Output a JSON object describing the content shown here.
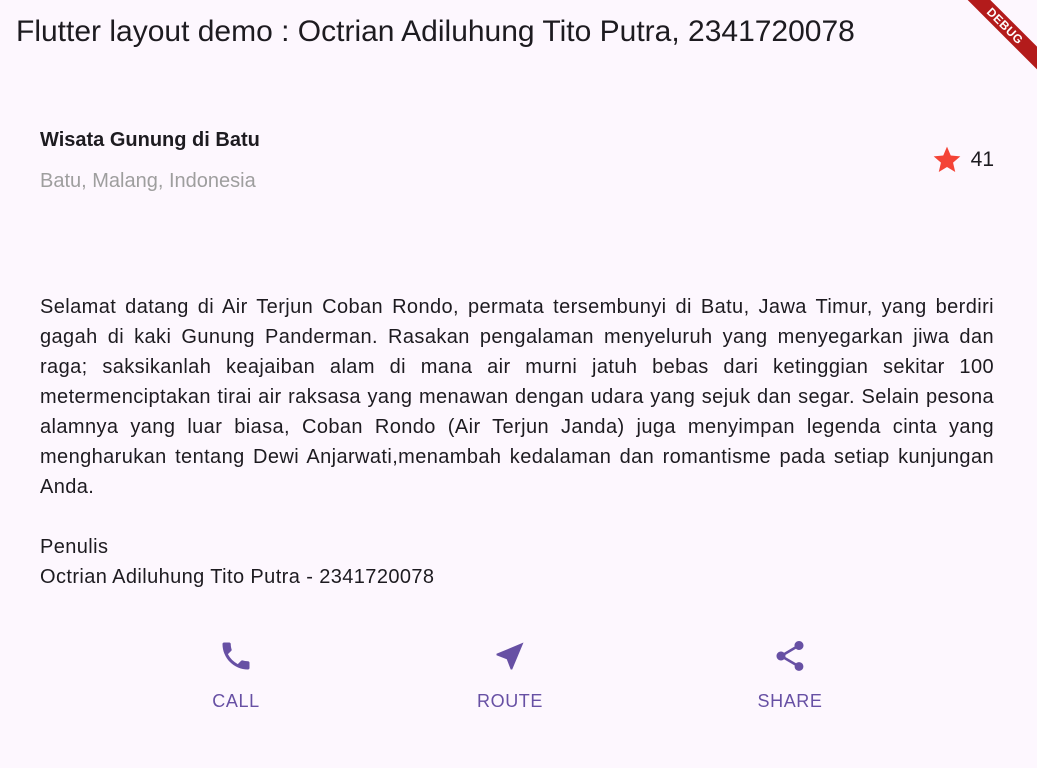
{
  "appbar": {
    "title": "Flutter layout demo : Octrian Adiluhung Tito Putra, 2341720078",
    "debug_banner": "DEBUG"
  },
  "title_section": {
    "name": "Wisata Gunung di Batu",
    "location": "Batu, Malang, Indonesia",
    "rating_icon": "star-icon",
    "rating_count": "41"
  },
  "description": {
    "text": "Selamat datang di Air Terjun Coban Rondo, permata tersembunyi di Batu, Jawa Timur, yang berdiri gagah di kaki Gunung Panderman. Rasakan pengalaman menyeluruh yang menyegarkan jiwa dan raga; saksikanlah keajaiban alam di mana air murni jatuh bebas dari ketinggian sekitar 100 metermenciptakan tirai air raksasa yang menawan dengan udara yang sejuk dan segar. Selain pesona alamnya yang luar biasa, Coban Rondo (Air Terjun Janda) juga menyimpan legenda cinta yang mengharukan tentang Dewi Anjarwati,menambah kedalaman dan romantisme pada setiap kunjungan Anda.",
    "writer_label": "Penulis",
    "writer_name": "Octrian Adiluhung Tito Putra - 2341720078"
  },
  "buttons": [
    {
      "label": "CALL",
      "icon": "phone-icon"
    },
    {
      "label": "ROUTE",
      "icon": "near-me-icon"
    },
    {
      "label": "SHARE",
      "icon": "share-icon"
    }
  ],
  "colors": {
    "background": "#fdf7fe",
    "accent": "#6750a4",
    "star": "#f44336",
    "secondary_text": "#9e9e9e",
    "debug_banner": "#b31b1b"
  }
}
